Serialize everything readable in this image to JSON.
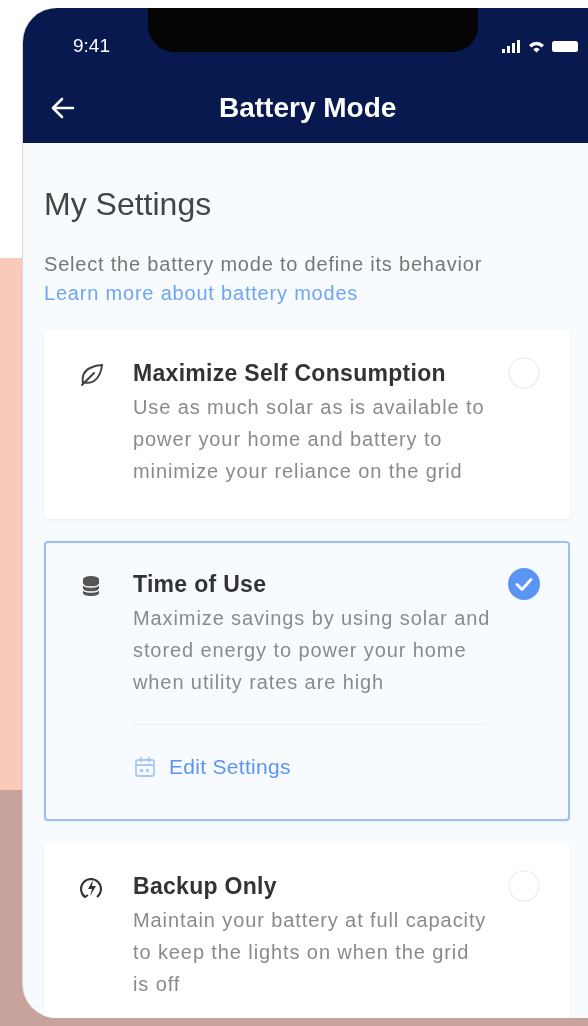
{
  "status_bar": {
    "time": "9:41"
  },
  "header": {
    "title": "Battery Mode"
  },
  "page": {
    "heading": "My Settings",
    "subtitle": "Select the battery mode to define its behavior",
    "link": "Learn more about battery modes"
  },
  "modes": [
    {
      "kind": "leaf",
      "title": "Maximize Self Consumption",
      "description": "Use as much solar as is available to power your home and battery to minimize your reliance on the grid",
      "selected": false
    },
    {
      "kind": "stack",
      "title": "Time of Use",
      "description": "Maximize savings by using solar and stored energy to power your home when utility rates are high",
      "selected": true,
      "action": "Edit Settings"
    },
    {
      "kind": "bolt",
      "title": "Backup Only",
      "description": "Maintain your battery at full capacity to keep the lights on when the grid is off",
      "selected": false
    }
  ]
}
